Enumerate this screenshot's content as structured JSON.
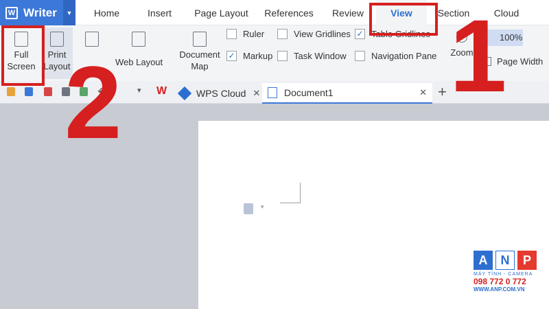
{
  "app": {
    "name": "Writer",
    "logo_letter": "W"
  },
  "menu_tabs": [
    "Home",
    "Insert",
    "Page Layout",
    "References",
    "Review",
    "View",
    "Section",
    "Cloud"
  ],
  "ribbon": {
    "full_screen": [
      "Full",
      "Screen"
    ],
    "print_layout": [
      "Print",
      "Layout"
    ],
    "web_layout": "Web Layout",
    "document_map": [
      "Document",
      "Map"
    ],
    "checkboxes": {
      "ruler": "Ruler",
      "view_gridlines": "View Gridlines",
      "table_gridlines": "Table Gridlines",
      "markup": "Markup",
      "task_window": "Task Window",
      "navigation_pane": "Navigation Pane"
    },
    "zoom": "Zoom",
    "zoom_level": "100%",
    "page_width": "Page Width"
  },
  "tabs": [
    {
      "label": "WPS Cloud"
    },
    {
      "label": "Document1"
    }
  ],
  "annotations": {
    "one": "1",
    "two": "2"
  },
  "watermark": {
    "letters": [
      "A",
      "N",
      "P"
    ],
    "sub": "MÁY TÍNH - CAMERA",
    "phone": "098 772 0 772",
    "web": "WWW.ANP.COM.VN"
  },
  "colors": {
    "accent": "#3c78d8",
    "annotation": "#d61f1f",
    "tile_a": "#2d6fd1",
    "tile_p": "#e53a2f"
  }
}
